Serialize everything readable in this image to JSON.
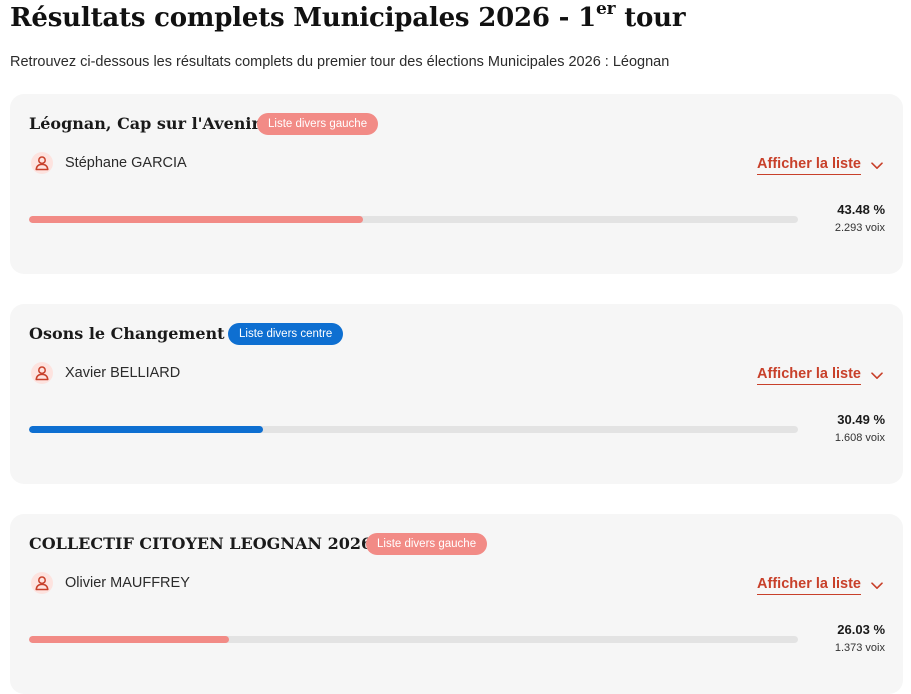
{
  "header": {
    "title_main": "Résultats complets Municipales 2026 - 1",
    "title_sup": "er",
    "title_end": " tour",
    "subtitle": "Retrouvez ci-dessous les résultats complets du premier tour des élections Municipales 2026 : Léognan"
  },
  "colors": {
    "gauche": "#f28b86",
    "centre": "#0e6fd1",
    "accent": "#c8402a"
  },
  "results": [
    {
      "list_name": "Léognan, Cap sur l'Avenir",
      "badge": "Liste divers gauche",
      "candidate": "Stéphane GARCIA",
      "action": "Afficher la liste",
      "percent": "43.48 %",
      "share": 0.4348,
      "votes": "2.293 voix",
      "color": "#f28b86"
    },
    {
      "list_name": "Osons le Changement",
      "badge": "Liste divers centre",
      "candidate": "Xavier BELLIARD",
      "action": "Afficher la liste",
      "percent": "30.49 %",
      "share": 0.3049,
      "votes": "1.608 voix",
      "color": "#0e6fd1"
    },
    {
      "list_name": "COLLECTIF CITOYEN LEOGNAN 2026",
      "badge": "Liste divers gauche",
      "candidate": "Olivier MAUFFREY",
      "action": "Afficher la liste",
      "percent": "26.03 %",
      "share": 0.2603,
      "votes": "1.373 voix",
      "color": "#f28b86"
    }
  ]
}
